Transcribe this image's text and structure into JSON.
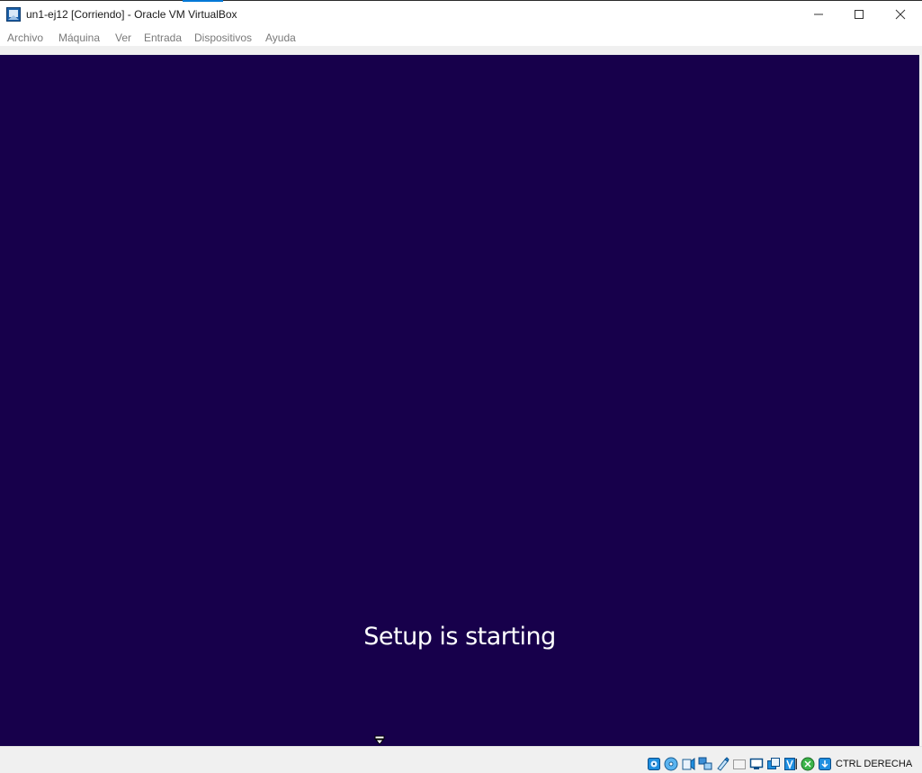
{
  "window": {
    "title": "un1-ej12 [Corriendo] - Oracle VM VirtualBox",
    "controls": [
      "minimize",
      "maximize",
      "close"
    ]
  },
  "menu": {
    "items": [
      "Archivo",
      "Máquina",
      "Ver",
      "Entrada",
      "Dispositivos",
      "Ayuda"
    ]
  },
  "vm": {
    "message": "Setup is starting",
    "background": "#17004b"
  },
  "statusbar": {
    "icons": [
      "hard-disk-icon",
      "optical-drive-icon",
      "audio-icon",
      "network-icon",
      "usb-icon",
      "shared-folders-icon",
      "display-icon",
      "video-capture-icon",
      "virtualization-icon",
      "mouse-integration-icon",
      "keyboard-icon"
    ],
    "host_key": "CTRL DERECHA"
  }
}
